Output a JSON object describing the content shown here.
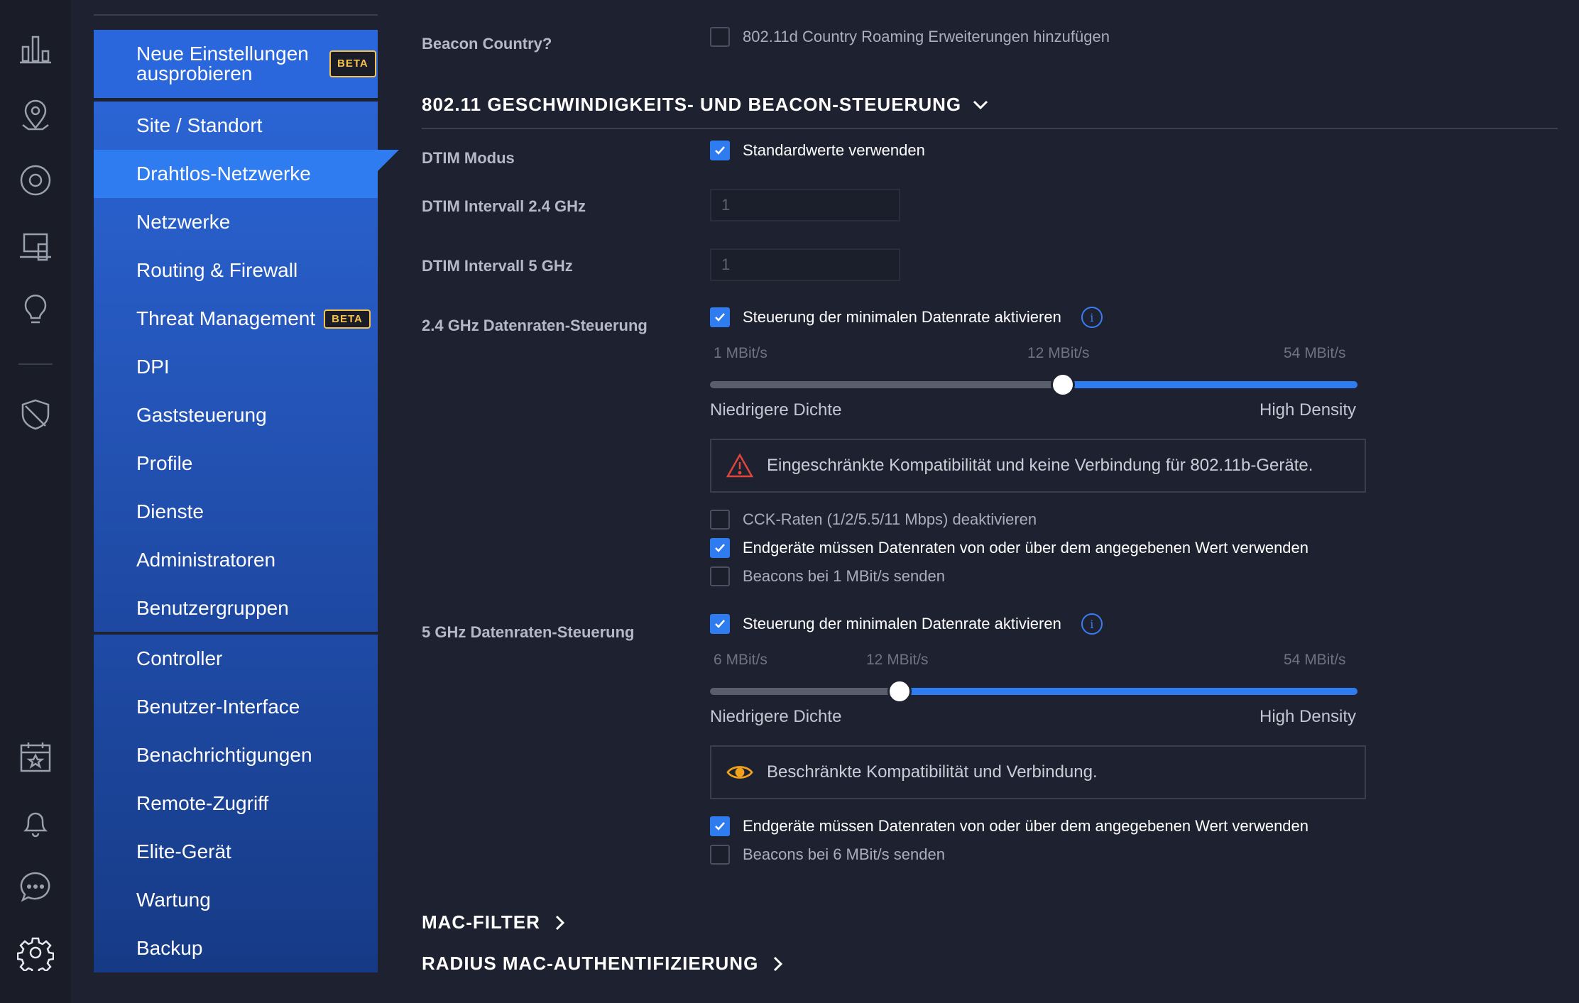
{
  "rail": {
    "icons": [
      "statistics-icon",
      "map-icon",
      "devices-icon",
      "clients-icon",
      "insights-icon",
      "threat-shield-icon",
      "calendar-star-icon",
      "bell-icon",
      "chat-icon",
      "gear-icon"
    ]
  },
  "nav": {
    "try_new": "Neue Einstellungen ausprobieren",
    "beta": "BETA",
    "items": [
      "Site / Standort",
      "Drahtlos-Netzwerke",
      "Netzwerke",
      "Routing & Firewall",
      "Threat Management",
      "DPI",
      "Gaststeuerung",
      "Profile",
      "Dienste",
      "Administratoren",
      "Benutzergruppen"
    ],
    "items2": [
      "Controller",
      "Benutzer-Interface",
      "Benachrichtigungen",
      "Remote-Zugriff",
      "Elite-Gerät",
      "Wartung",
      "Backup"
    ]
  },
  "content": {
    "beacon_country_label": "Beacon Country?",
    "beacon_country_cb": "802.11d Country Roaming Erweiterungen hinzufügen",
    "section_speed": "802.11 GESCHWINDIGKEITS- UND BEACON-STEUERUNG",
    "dtim_mode_label": "DTIM Modus",
    "dtim_mode_cb": "Standardwerte verwenden",
    "dtim24_label": "DTIM Intervall 2.4 GHz",
    "dtim24_value": "1",
    "dtim5_label": "DTIM Intervall 5 GHz",
    "dtim5_value": "1",
    "rate24_label": "2.4 GHz Datenraten-Steuerung",
    "rate24_cb": "Steuerung der minimalen Datenrate aktivieren",
    "rate24_ticks": [
      "1 MBit/s",
      "12 MBit/s",
      "54 MBit/s"
    ],
    "rate24_level": 0.545,
    "density_low": "Niedrigere Dichte",
    "density_high": "High Density",
    "rate24_alert": "Eingeschränkte Kompatibilität und keine Verbindung für 802.11b-Geräte.",
    "cck_cb": "CCK-Raten (1/2/5.5/11 Mbps) deaktivieren",
    "clients_rate_cb": "Endgeräte müssen Datenraten von oder über dem angegebenen Wert verwenden",
    "beacon1_cb": "Beacons bei 1 MBit/s senden",
    "rate5_label": "5 GHz Datenraten-Steuerung",
    "rate5_cb": "Steuerung der minimalen Datenrate aktivieren",
    "rate5_ticks": [
      "6 MBit/s",
      "12 MBit/s",
      "54 MBit/s"
    ],
    "rate5_level": 0.293,
    "rate5_alert": "Beschränkte Kompatibilität und Verbindung.",
    "clients_rate5_cb": "Endgeräte müssen Datenraten von oder über dem angegebenen Wert verwenden",
    "beacon6_cb": "Beacons bei 6 MBit/s senden",
    "section_mac": "MAC-FILTER",
    "section_radius": "RADIUS MAC-AUTHENTIFIZIERUNG"
  },
  "colors": {
    "accent": "#2f7bf0",
    "warning_red": "#e0453a",
    "warning_amber": "#f0a21c"
  }
}
